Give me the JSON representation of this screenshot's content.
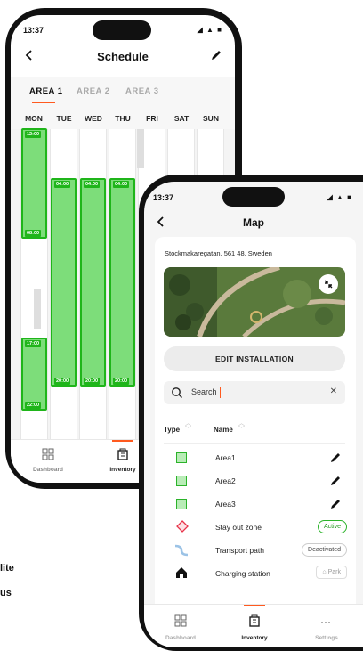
{
  "colors": {
    "accent": "#ff5a1f",
    "green": "#1fb51a",
    "greenFill": "#7ddd7a"
  },
  "schedule": {
    "time": "13:37",
    "title": "Schedule",
    "area_tabs": [
      "AREA 1",
      "AREA 2",
      "AREA 3"
    ],
    "days": [
      "MON",
      "TUE",
      "WED",
      "THU",
      "FRI",
      "SAT",
      "SUN"
    ],
    "blocks": {
      "mon1_start": "12:00",
      "mon1_end": "08:00",
      "mon2_start": "17:00",
      "mon2_end": "22:00",
      "tue_start": "04:00",
      "tue_end": "20:00",
      "wed_start": "04:00",
      "wed_end": "20:00",
      "thu_start": "04:00",
      "thu_end": "20:00"
    },
    "nav": {
      "dashboard": "Dashboard",
      "inventory": "Inventory"
    }
  },
  "map": {
    "time": "13:37",
    "title": "Map",
    "address": "Stockmakaregatan, 561 48, Sweden",
    "edit_button": "EDIT INSTALLATION",
    "search_placeholder": "Search",
    "col_type": "Type",
    "col_name": "Name",
    "items": [
      {
        "name": "Area1"
      },
      {
        "name": "Area2"
      },
      {
        "name": "Area3"
      },
      {
        "name": "Stay out zone",
        "status": "Active"
      },
      {
        "name": "Transport path",
        "status": "Deactivated"
      },
      {
        "name": "Charging station",
        "status": "Park"
      }
    ],
    "nav": {
      "dashboard": "Dashboard",
      "inventory": "Inventory",
      "settings": "Settings"
    }
  },
  "caption": {
    "line1": "lite",
    "line2": "us"
  }
}
